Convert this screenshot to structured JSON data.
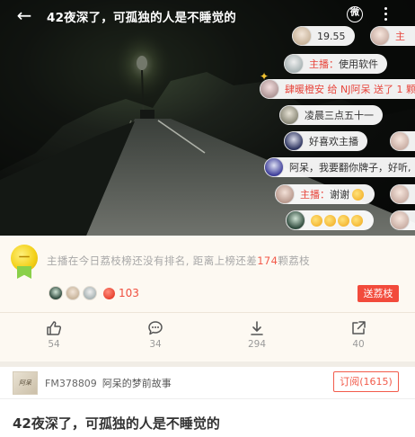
{
  "header": {
    "title": "42夜深了，可孤独的人是不睡觉的",
    "back_glyph": "←",
    "share_glyph": "微"
  },
  "chat": {
    "messages": [
      {
        "user": "",
        "text": "19.55"
      },
      {
        "user": "主播：",
        "text": "使用软件"
      },
      {
        "user": "",
        "text": "肆暖橙安 给 NJ阿呆 送了 1 颗"
      },
      {
        "user": "",
        "text": "凌晨三点五十一"
      },
      {
        "user": "",
        "text": "好喜欢主播"
      },
      {
        "user": "",
        "text": "阿呆，我要翻你牌子，好听,"
      },
      {
        "user": "主播：",
        "text": "谢谢"
      },
      {
        "user": "",
        "text": ""
      },
      {
        "user": "",
        "text": "主"
      }
    ]
  },
  "litchi": {
    "rank_prefix": "主播在今日荔枝榜还没有排名, 距离上榜还差",
    "rank_number": "174",
    "rank_suffix": "颗荔枝",
    "count": "103",
    "send_label": "送荔枝"
  },
  "actions": {
    "like": {
      "icon": "thumbs-up-icon",
      "count": "54"
    },
    "comment": {
      "icon": "comment-icon",
      "count": "34"
    },
    "download": {
      "icon": "download-icon",
      "count": "294"
    },
    "share": {
      "icon": "share-icon",
      "count": "40"
    }
  },
  "channel": {
    "id": "FM378809",
    "name": "阿呆的梦前故事",
    "subscribe_label": "订阅(1615)"
  },
  "episode": {
    "title": "42夜深了，可孤独的人是不睡觉的"
  },
  "colors": {
    "accent": "#f24b3c",
    "panel_bg": "#fdf9f2",
    "muted_text": "#9a9a9a"
  }
}
